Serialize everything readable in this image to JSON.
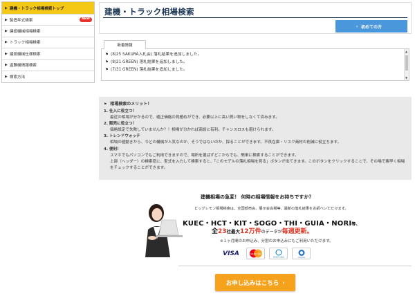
{
  "sidebar": {
    "items": [
      {
        "label": "建機・トラック相場検索トップ",
        "active": true
      },
      {
        "label": "製造年式検索",
        "badge": "NEW"
      },
      {
        "label": "建設機械相場検索"
      },
      {
        "label": "トラック相場検索"
      },
      {
        "label": "建設機械仕様検索"
      },
      {
        "label": "盗難機情報検索"
      },
      {
        "label": "検索方法"
      }
    ]
  },
  "header": {
    "title": "建機・トラック相場検索",
    "first_time_button": "初めての方"
  },
  "news": {
    "tab_label": "新着情報",
    "items": [
      "(8/25 SAKURA入札会) 落札結果を追加しました。",
      "(8/21 GREEN) 落札結果を追加しました。",
      "(7/31 GREEN) 落札結果を追加しました。"
    ]
  },
  "merit": {
    "title": "相場検索のメリット！",
    "items": [
      {
        "head": "1. 仕入に役立つ！",
        "body": "最近の相場が分かるので、適正価格の見極めができ、必要以上に高い買い物をしなくて済みます。"
      },
      {
        "head": "2. 販売に役立つ！",
        "body": "価格設定で失敗していませんか？！相場が分かれば商談に有利。チャンスロスも避けられます。"
      },
      {
        "head": "3. トレンドウォッチ",
        "body": "相場の値動きから、今どの機械が人気なのか、そうではないのか、探ることができます。不良在庫・リスク商材の削減に役立ちます。"
      },
      {
        "head": "4. 便利！",
        "body": "スマホでもパソコンでもご利用できますので、場所を選ばずどこからでも、簡単に検索することができます。\n上部（ヘッダー）の検索窓に、型式を入力して検索すると、「このモデルの落札相場を見る」ボタンが出てきます。このボタンをクリックすることで、その場で素早く相場をチェックすることができます。"
      }
    ]
  },
  "promo": {
    "heading": "建機相場の急変！ 何時の相場情報をお持ちですか？",
    "sub": "ビッグレモン相場検索は、全国部売会、展示会会場等、最新の落札結果をお調べいただけます。",
    "brands": "KUEC・HCT・KIT・SOGO・THI・GUIA・NORI",
    "brands_suffix": "等、",
    "line2_a": "全",
    "line2_num1": "23",
    "line2_b": "社最大",
    "line2_num2": "12万件",
    "line2_c": "のデータが",
    "line2_d": "毎週更新。",
    "note": "※１ヶ月間のお申込み、分割のお申込みにもご利用いただけます。",
    "cards": [
      "VISA",
      "MasterCard",
      "Diners Club",
      "Cedyna"
    ],
    "apply_button": "お申し込みはこちら"
  },
  "colors": {
    "accent_yellow": "#f5c816",
    "title_navy": "#1a3552",
    "button_blue": "#4b97db",
    "apply_orange": "#f6a21c",
    "highlight_red": "#e0301e"
  }
}
